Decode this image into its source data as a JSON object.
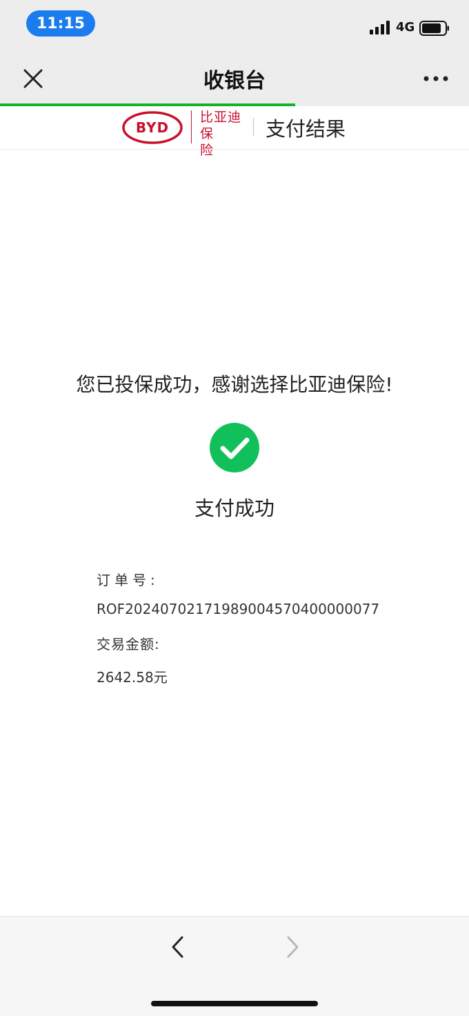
{
  "status_bar": {
    "time": "11:15",
    "network": "4G",
    "icons": [
      "signal-icon",
      "battery-icon"
    ]
  },
  "title_bar": {
    "title": "收银台",
    "icons": [
      "close-icon",
      "more-icon"
    ]
  },
  "progress": {
    "value": 0.63,
    "color": "#14b22a"
  },
  "brand": {
    "logo_text": "BYD",
    "name_line1": "比亚迪",
    "name_line2": "保险",
    "subtitle": "支付结果",
    "brand_color": "#c8102e"
  },
  "result": {
    "thanks": "您已投保成功，感谢选择比亚迪保险!",
    "status_icon": "check-circle-icon",
    "status_color": "#12c05b",
    "status_label": "支付成功"
  },
  "details": {
    "order_label": "订单号:",
    "order_value": "ROF20240702171989004570400000077",
    "amount_label": "交易金额:",
    "amount_value": "2642.58元"
  },
  "bottom_nav": {
    "icons": [
      "back-chevron-icon",
      "forward-chevron-icon"
    ]
  }
}
